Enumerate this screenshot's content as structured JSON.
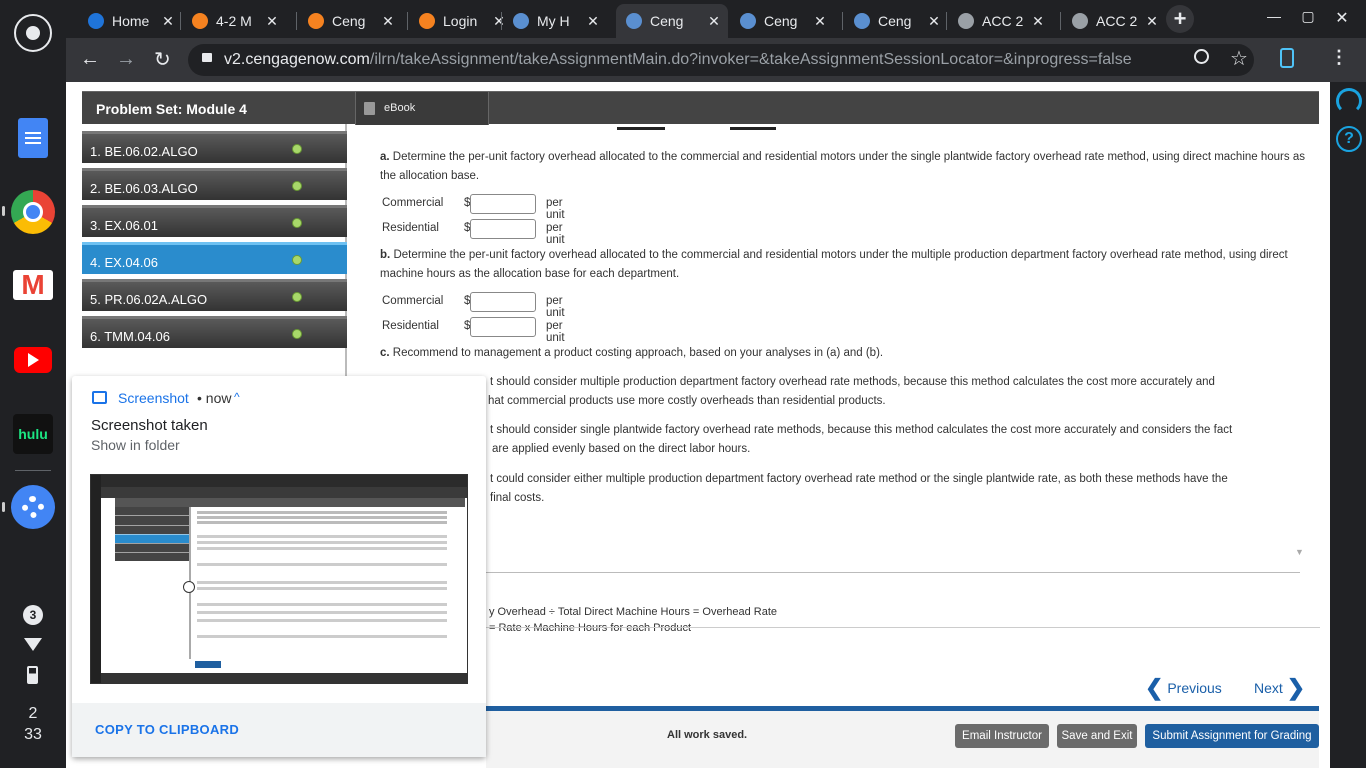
{
  "browser": {
    "tabs": [
      {
        "label": "Home",
        "icon": "cengage-bird-icon"
      },
      {
        "label": "4-2 M",
        "icon": "brightspace-b-icon"
      },
      {
        "label": "Ceng",
        "icon": "brightspace-b-icon"
      },
      {
        "label": "Login",
        "icon": "brightspace-b-icon"
      },
      {
        "label": "My H",
        "icon": "cengage-sparkle-icon"
      },
      {
        "label": "Ceng",
        "icon": "cengage-sparkle-icon"
      },
      {
        "label": "Ceng",
        "icon": "cengage-sparkle-icon"
      },
      {
        "label": "Ceng",
        "icon": "cengage-sparkle-icon"
      },
      {
        "label": "ACC 2",
        "icon": "globe-icon"
      },
      {
        "label": "ACC 2",
        "icon": "globe-icon"
      }
    ],
    "active_tab": 5,
    "new_tab": "+",
    "close": "✕",
    "url_host": "v2.cengagenow.com",
    "url_path": "/ilrn/takeAssignment/takeAssignmentMain.do?invoker=&takeAssignmentSessionLocator=&inprogress=false",
    "window_min": "—",
    "window_max": "▢",
    "window_close": "✕"
  },
  "assignment": {
    "title": "Problem Set: Module 4",
    "ebook": "eBook",
    "questions": [
      {
        "label": "1. BE.06.02.ALGO",
        "done": true
      },
      {
        "label": "2. BE.06.03.ALGO",
        "done": true
      },
      {
        "label": "3. EX.06.01",
        "done": true
      },
      {
        "label": "4. EX.04.06",
        "done": true,
        "selected": true
      },
      {
        "label": "5. PR.06.02A.ALGO",
        "done": true
      },
      {
        "label": "6. TMM.04.06",
        "done": true
      }
    ]
  },
  "content": {
    "part_a_letter": "a.",
    "part_a": "Determine the per-unit factory overhead allocated to the commercial and residential motors under the single plantwide factory overhead rate method, using direct machine hours as the allocation base.",
    "part_b_letter": "b.",
    "part_b": "Determine the per-unit factory overhead allocated to the commercial and residential motors under the multiple production department factory overhead rate method, using direct machine hours as the allocation base for each department.",
    "part_c_letter": "c.",
    "part_c": "Recommend to management a product costing approach, based on your analyses in (a) and (b).",
    "commercial": "Commercial",
    "residential": "Residential",
    "dollar": "$",
    "per_unit": "per unit",
    "option1_l1": "t should consider multiple production department factory overhead rate methods, because this method calculates the cost more accurately and",
    "option1_l2": "hat commercial products use more costly overheads than residential products.",
    "option2_l1": "t should consider single plantwide factory overhead rate methods, because this method calculates the cost more accurately and considers the fact",
    "option2_l2": "are applied evenly based on the direct labor hours.",
    "option3_l1": "t could consider either multiple production department factory overhead rate method or the single plantwide rate, as both these methods have the",
    "option3_l2": "final costs.",
    "hint_line1": "y Overhead ÷ Total Direct Machine Hours = Overhead Rate",
    "hint_line2": "= Rate x Machine Hours for each Product",
    "previous": "Previous",
    "next": "Next",
    "all_saved": "All work saved.",
    "email_instructor": "Email Instructor",
    "save_exit": "Save and Exit",
    "submit": "Submit Assignment for Grading"
  },
  "notification": {
    "app": "Screenshot",
    "time": "• now",
    "title": "Screenshot taken",
    "subtitle": "Show in folder",
    "action": "COPY TO CLIPBOARD"
  },
  "shelf": {
    "badge": "3",
    "clock_hour": "2",
    "clock_min": "33",
    "hulu_label": "hulu"
  },
  "colors": {
    "selected_question": "#2a8ccd",
    "link_blue": "#1a5fa9",
    "submit_blue": "#1f5fa0"
  }
}
